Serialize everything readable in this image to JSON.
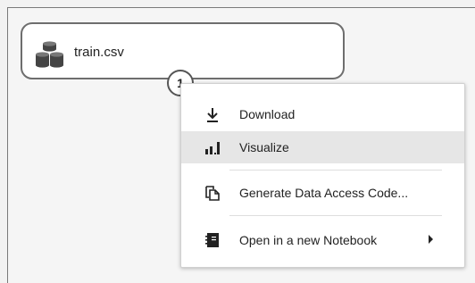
{
  "module": {
    "label": "train.csv",
    "icon": "dataset-icon",
    "output_port": "1"
  },
  "context_menu": {
    "items": [
      {
        "label": "Download",
        "icon": "download-icon",
        "highlighted": false
      },
      {
        "label": "Visualize",
        "icon": "bar-chart-icon",
        "highlighted": true
      },
      {
        "label": "Generate Data Access Code...",
        "icon": "copy-document-icon",
        "highlighted": false
      },
      {
        "label": "Open in a new Notebook",
        "icon": "notebook-icon",
        "highlighted": false,
        "has_submenu": true
      }
    ]
  }
}
